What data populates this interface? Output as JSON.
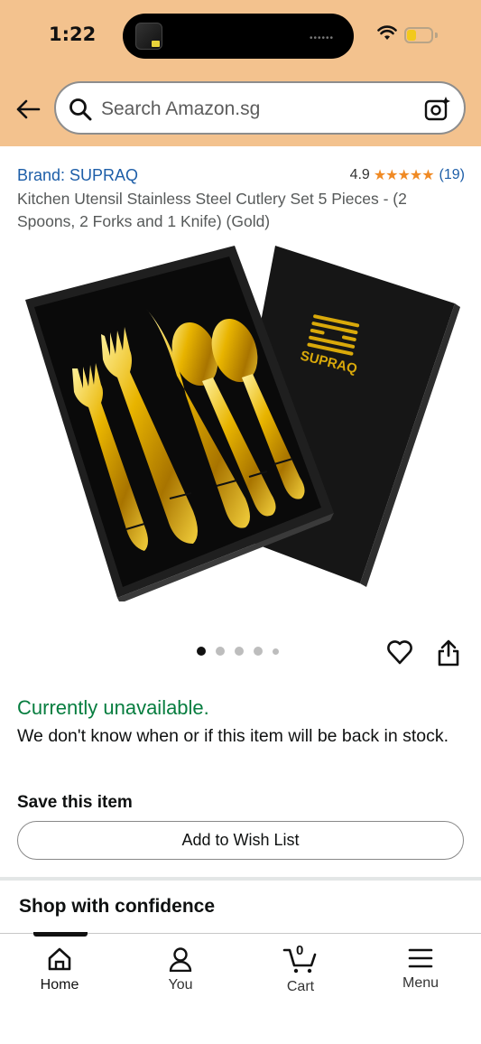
{
  "status_bar": {
    "time": "1:22"
  },
  "search": {
    "placeholder": "Search Amazon.sg"
  },
  "product": {
    "brand": "Brand: SUPRAQ",
    "rating": "4.9",
    "stars": "★★★★★",
    "review_count": "(19)",
    "title": "Kitchen Utensil Stainless Steel Cutlery Set 5 Pieces - (2 Spoons, 2 Forks and 1 Knife) (Gold)",
    "image_logo_text": "SUPRAQ"
  },
  "carousel": {
    "total": 5,
    "active": 1
  },
  "availability": {
    "status": "Currently unavailable.",
    "message": "We don't know when or if this item will be back in stock."
  },
  "save": {
    "title": "Save this item",
    "button": "Add to Wish List"
  },
  "section": {
    "confidence": "Shop with confidence"
  },
  "nav": {
    "home": "Home",
    "you": "You",
    "cart": "Cart",
    "cart_count": "0",
    "menu": "Menu"
  },
  "colors": {
    "header_bg": "#f3c28e",
    "link": "#1d5ea8",
    "unavailable": "#067d3f",
    "star": "#f08a24"
  }
}
